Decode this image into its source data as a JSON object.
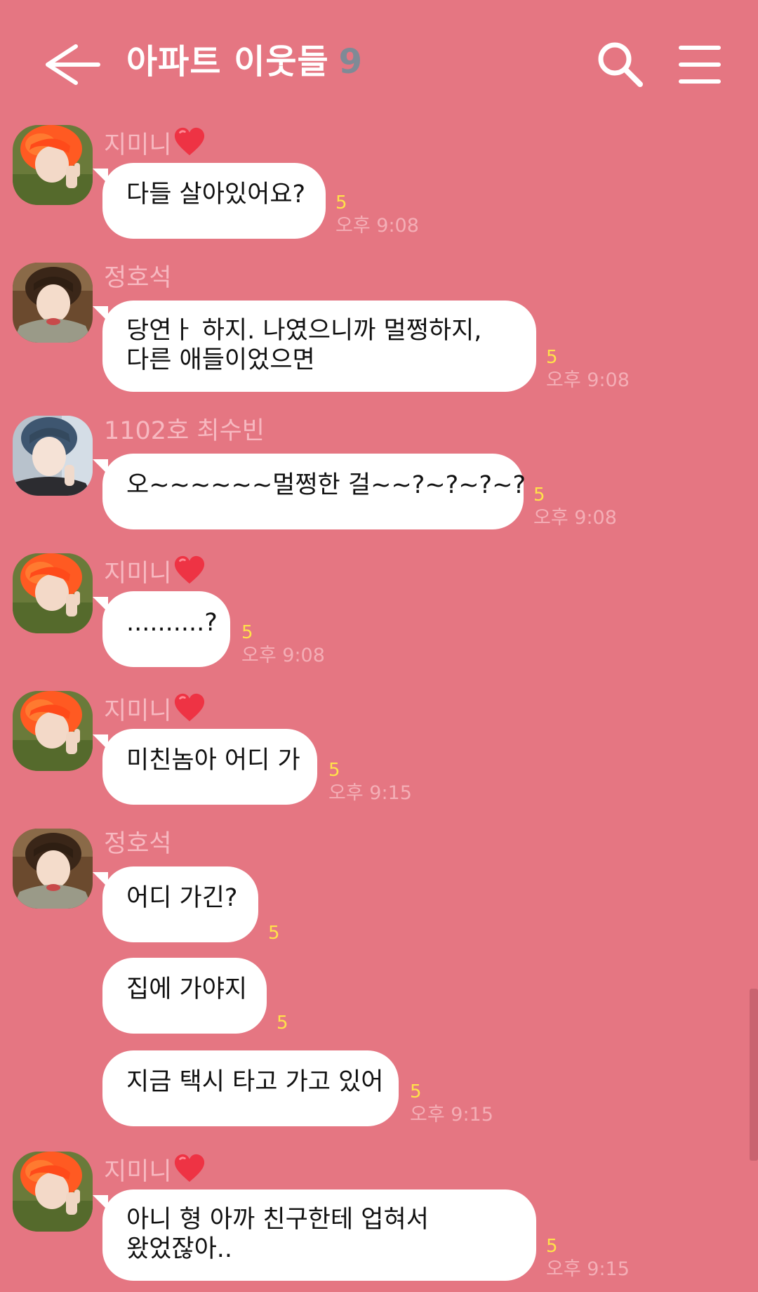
{
  "header": {
    "title": "아파트 이웃들",
    "member_count": "9",
    "back_icon": "arrow-left-icon",
    "search_icon": "search-icon",
    "menu_icon": "hamburger-menu-icon"
  },
  "colors": {
    "background": "#e57682",
    "bubble": "#ffffff",
    "sender_name": "#f7b8c0",
    "unread_count": "#ffe24a",
    "timestamp": "#f4aeb6",
    "member_count": "#7f8a96"
  },
  "messages": [
    {
      "sender": "지미니",
      "text": "다들 살아있어요?",
      "unread": "5",
      "time": "오후 9:08"
    },
    {
      "sender": "정호석",
      "lines": [
        "당연ㅏ 하지. 나였으니까 멀쩡하지,",
        "다른 애들이었으면"
      ],
      "unread": "5",
      "time": "오후 9:08"
    },
    {
      "sender": "1102호 최수빈",
      "text": "오~~~~~~멀쩡한 걸~~?~?~?~?",
      "unread": "5",
      "time": "오후 9:08"
    },
    {
      "sender": "지미니",
      "text": "..........?",
      "unread": "5",
      "time": "오후 9:08"
    },
    {
      "sender": "지미니",
      "text": "미친놈아 어디 가",
      "unread": "5",
      "time": "오후 9:15"
    },
    {
      "sender": "정호석",
      "text": "어디 가긴?",
      "unread": "5"
    },
    {
      "text": "집에 가야지",
      "unread": "5"
    },
    {
      "text": "지금 택시 타고 가고 있어",
      "unread": "5",
      "time": "오후 9:15"
    },
    {
      "sender": "지미니",
      "lines": [
        "아니 형 아까 친구한테 업혀서",
        "왔었잖아.."
      ],
      "unread": "5",
      "time": "오후 9:15"
    }
  ]
}
